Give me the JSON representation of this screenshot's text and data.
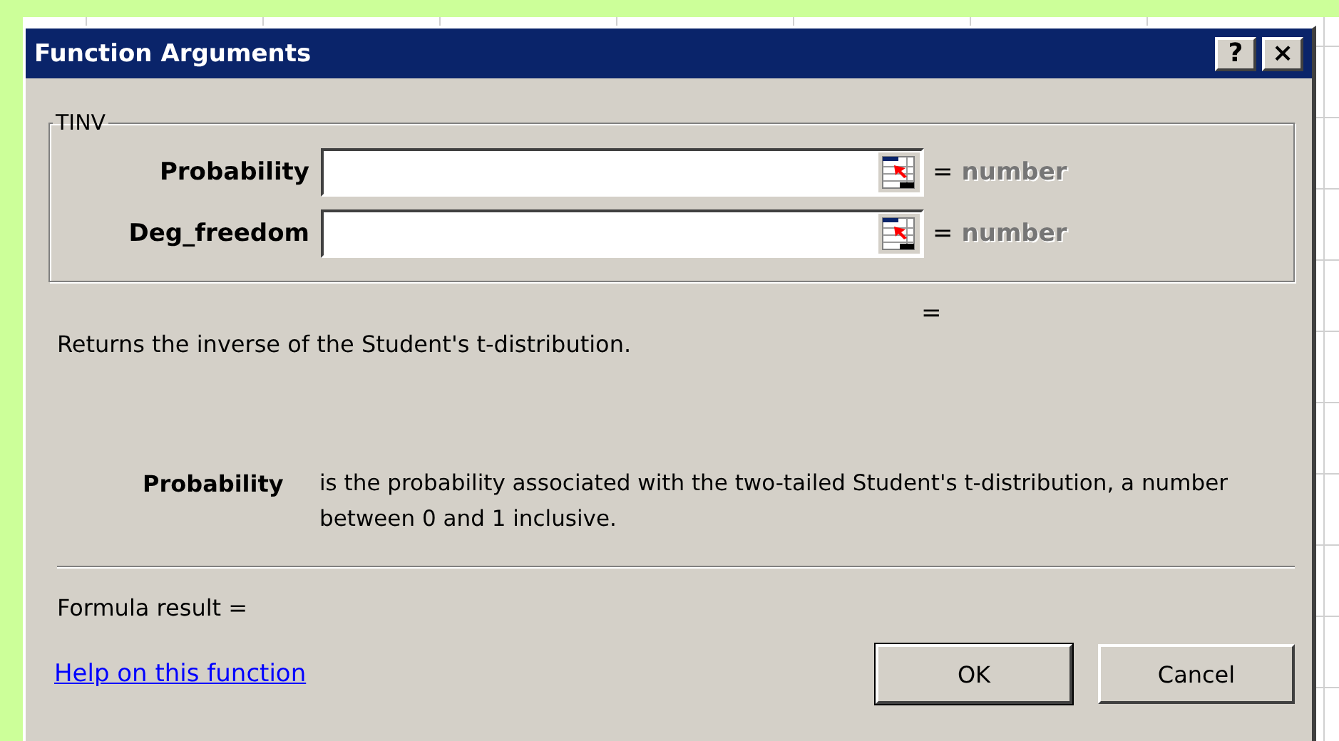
{
  "window": {
    "title": "Function Arguments",
    "buttons": [
      "?",
      "×"
    ]
  },
  "group": {
    "title": "TINV",
    "arguments": [
      {
        "label": "Probability",
        "equals": "=",
        "result": "number"
      },
      {
        "label": "Deg_freedom",
        "equals": "=",
        "result": "number"
      }
    ]
  },
  "function_result": "=",
  "description": "Returns the inverse of the Student's t-distribution.",
  "argument_help": {
    "name": "Probability",
    "text": "is the probability associated with the two-tailed Student's t-distribution, a number between 0 and 1 inclusive."
  },
  "formula_result": "Formula result =",
  "help_link": "Help on this function",
  "buttons": [
    "OK",
    "Cancel"
  ]
}
